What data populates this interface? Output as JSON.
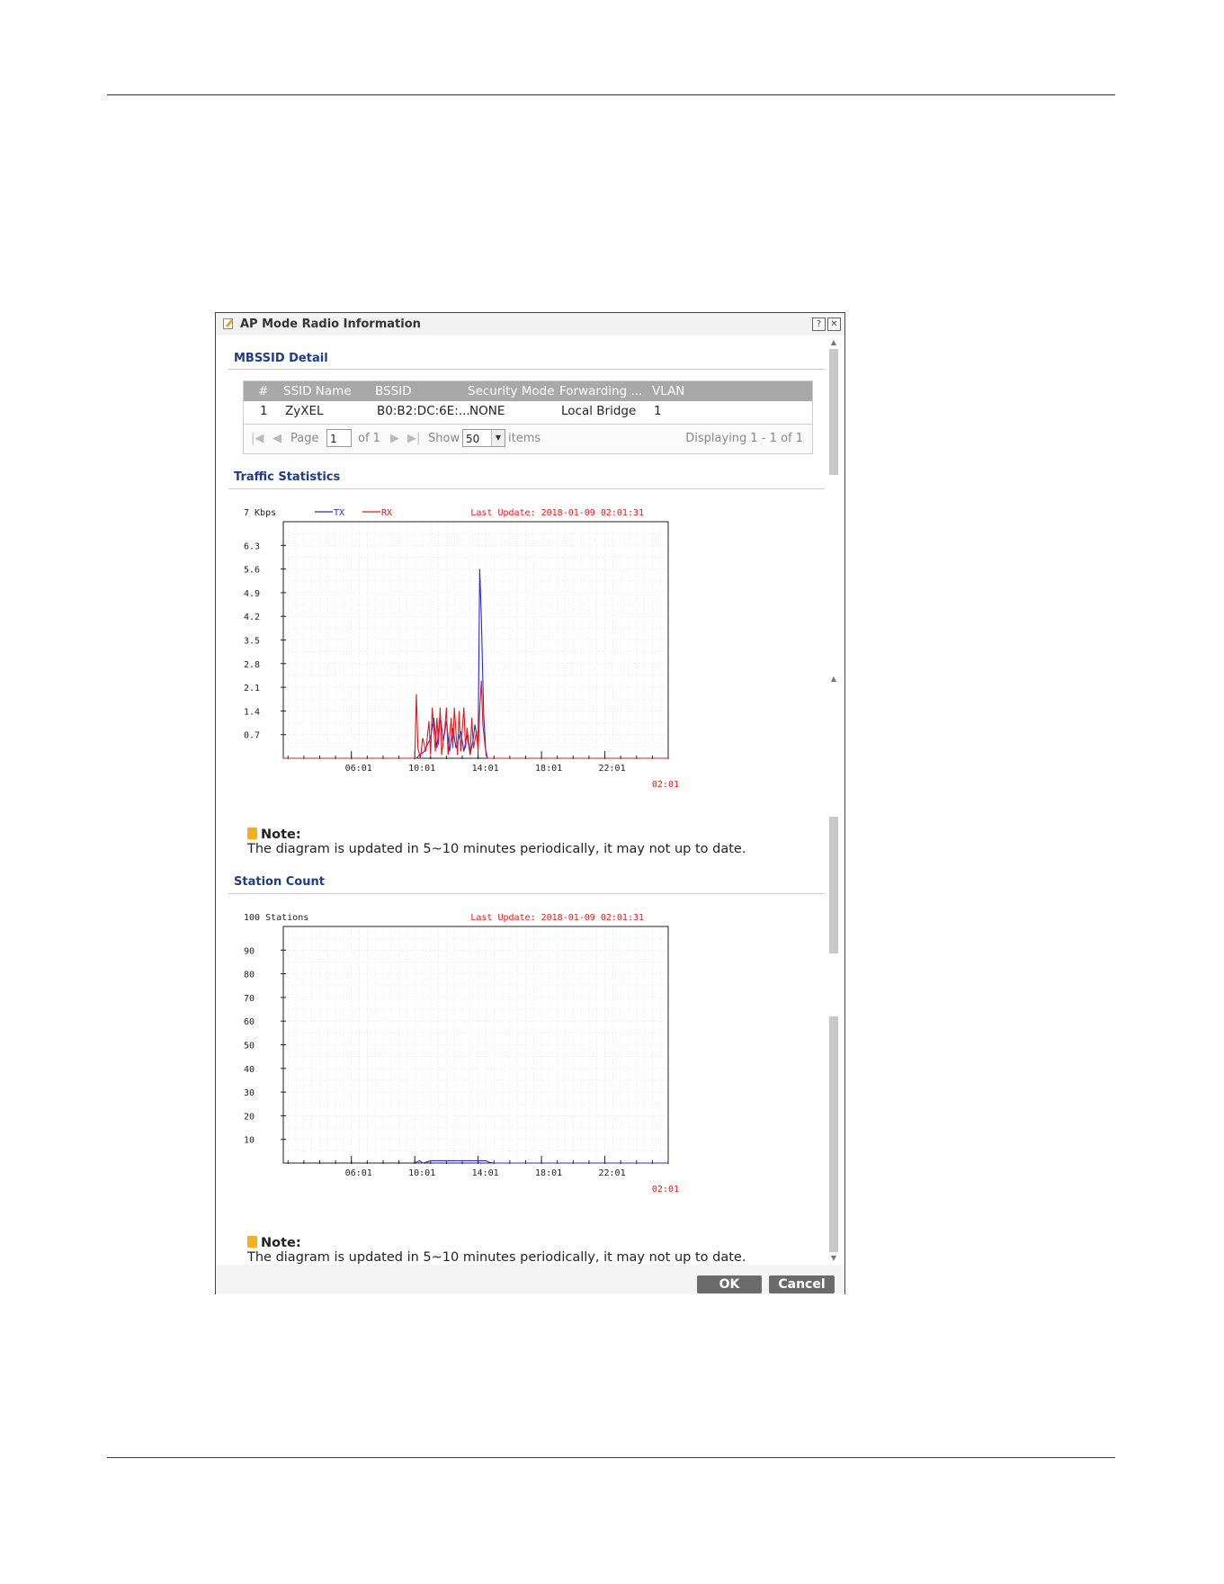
{
  "dialog": {
    "title": "AP Mode Radio Information",
    "help_icon": "question-icon",
    "close_icon": "close-icon"
  },
  "mbssid": {
    "title": "MBSSID Detail",
    "columns": [
      "#",
      "SSID Name",
      "BSSID",
      "Security Mode",
      "Forwarding ...",
      "VLAN"
    ],
    "rows": [
      [
        "1",
        "ZyXEL",
        "B0:B2:DC:6E:...",
        "NONE",
        "Local Bridge",
        "1"
      ]
    ],
    "pager": {
      "page_label": "Page",
      "page_value": "1",
      "of_label": "of 1",
      "show_label": "Show",
      "show_value": "50",
      "items_label": "items",
      "displaying": "Displaying 1 - 1 of 1"
    }
  },
  "traffic": {
    "title": "Traffic Statistics",
    "note_label": "Note:",
    "note_text": "The diagram is updated in 5~10 minutes periodically, it may not up to date.",
    "chart_data": {
      "type": "line",
      "unit_label": "7 Kbps",
      "last_update": "Last Update: 2018-01-09 02:01:31",
      "current_time": "02:01",
      "y_ticks": [
        "6.3",
        "5.6",
        "4.9",
        "4.2",
        "3.5",
        "2.8",
        "2.1",
        "1.4",
        "0.7"
      ],
      "y_tick_values": [
        6.3,
        5.6,
        4.9,
        4.2,
        3.5,
        2.8,
        2.1,
        1.4,
        0.7
      ],
      "ylim": [
        0,
        7
      ],
      "x_ticks": [
        "06:01",
        "10:01",
        "14:01",
        "18:01",
        "22:01"
      ],
      "x_tick_hours": [
        6,
        10,
        14,
        18,
        22
      ],
      "xlim": [
        1.7,
        26
      ],
      "grid": true,
      "legend_position": "top",
      "series": [
        {
          "name": "TX",
          "color": "#2b2bd6",
          "x": [
            1.7,
            10.1,
            10.3,
            10.6,
            11.0,
            11.2,
            11.4,
            11.6,
            11.8,
            12.0,
            12.2,
            12.4,
            12.6,
            12.9,
            13.1,
            13.3,
            13.5,
            13.7,
            13.8,
            14.0,
            14.1,
            14.2,
            14.35,
            14.5,
            14.6,
            26
          ],
          "y": [
            0,
            0,
            0.1,
            0.2,
            0.6,
            1.2,
            0.3,
            1.3,
            0.5,
            1.1,
            0.2,
            0.9,
            0.3,
            0.8,
            0.2,
            0.7,
            0.1,
            0.6,
            1.0,
            0.4,
            5.6,
            4.2,
            1.3,
            0.1,
            0,
            0
          ]
        },
        {
          "name": "RX",
          "color": "#e01b1b",
          "x": [
            1.7,
            10.0,
            10.1,
            10.2,
            10.35,
            10.5,
            10.7,
            10.9,
            11.0,
            11.1,
            11.3,
            11.4,
            11.5,
            11.6,
            11.7,
            11.9,
            12.0,
            12.1,
            12.3,
            12.4,
            12.5,
            12.7,
            12.8,
            12.9,
            13.1,
            13.2,
            13.3,
            13.5,
            13.6,
            13.7,
            13.9,
            14.0,
            14.1,
            14.2,
            14.3,
            14.45,
            14.6,
            26
          ],
          "y": [
            0,
            0,
            1.9,
            0.3,
            0,
            0.6,
            0.2,
            1.1,
            0.1,
            1.5,
            0.2,
            1.2,
            0.4,
            1.5,
            0.1,
            0.9,
            1.5,
            0.1,
            1.2,
            0.3,
            1.5,
            0.1,
            1.4,
            0.2,
            1.5,
            0.3,
            0.9,
            0.1,
            1.2,
            0.3,
            0.8,
            0.2,
            1.4,
            2.3,
            1.0,
            0.3,
            0,
            0
          ]
        }
      ]
    }
  },
  "station": {
    "title": "Station Count",
    "note_label": "Note:",
    "note_text": "The diagram is updated in 5~10 minutes periodically, it may not up to date.",
    "chart_data": {
      "type": "line",
      "unit_label": "100 Stations",
      "last_update": "Last Update: 2018-01-09 02:01:31",
      "current_time": "02:01",
      "y_ticks": [
        "90",
        "80",
        "70",
        "60",
        "50",
        "40",
        "30",
        "20",
        "10"
      ],
      "y_tick_values": [
        90,
        80,
        70,
        60,
        50,
        40,
        30,
        20,
        10
      ],
      "ylim": [
        0,
        100
      ],
      "x_ticks": [
        "06:01",
        "10:01",
        "14:01",
        "18:01",
        "22:01"
      ],
      "x_tick_hours": [
        6,
        10,
        14,
        18,
        22
      ],
      "xlim": [
        1.7,
        26
      ],
      "grid": true,
      "series": [
        {
          "name": "",
          "color": "#2b2bd6",
          "x": [
            10.0,
            10.3,
            10.5,
            10.8,
            11.0,
            14.5,
            14.7,
            15.0,
            26
          ],
          "y": [
            0,
            1,
            0,
            0.5,
            1,
            1,
            0.3,
            0,
            0
          ]
        }
      ]
    }
  },
  "buttons": {
    "ok": "OK",
    "cancel": "Cancel"
  }
}
